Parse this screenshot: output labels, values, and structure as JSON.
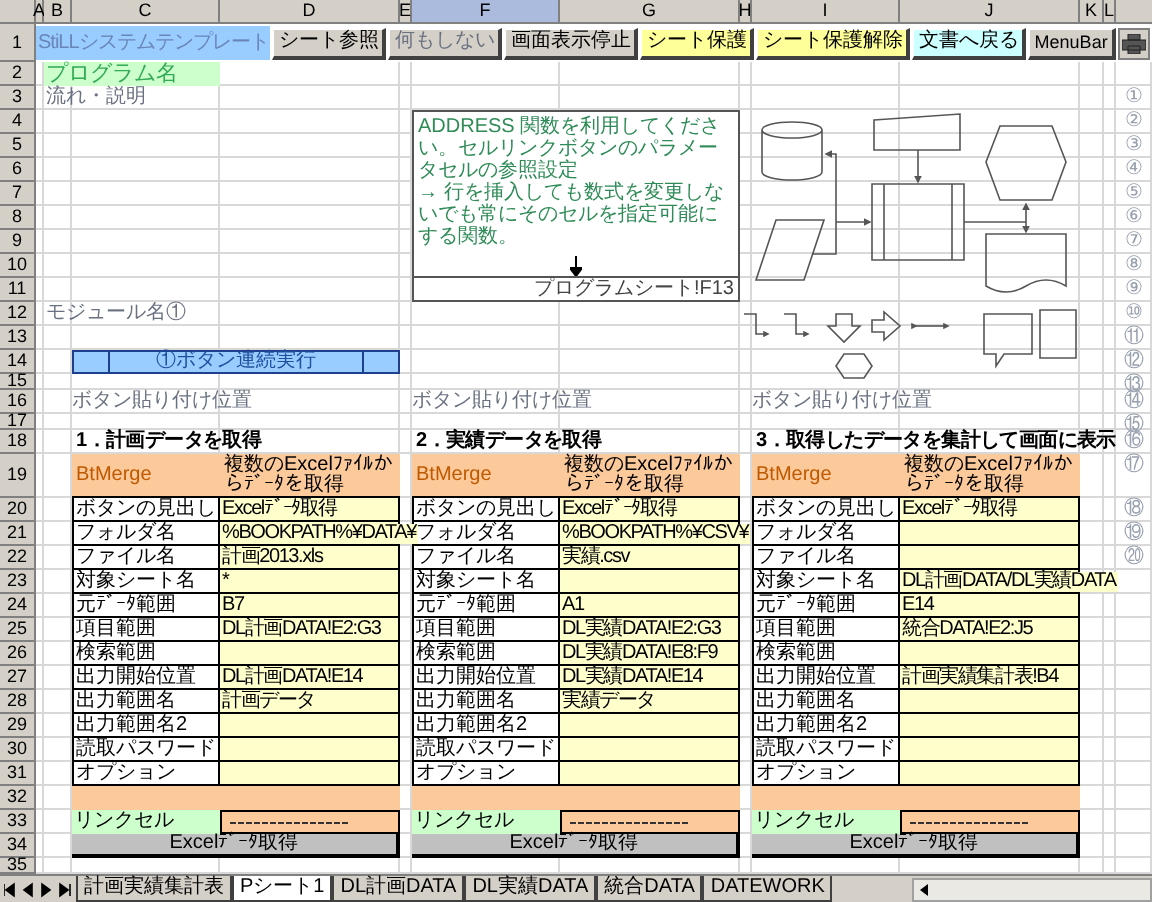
{
  "columns": [
    {
      "label": "A",
      "selected": false
    },
    {
      "label": "B",
      "selected": false
    },
    {
      "label": "C",
      "selected": false
    },
    {
      "label": "D",
      "selected": false
    },
    {
      "label": "E",
      "selected": false
    },
    {
      "label": "F",
      "selected": true
    },
    {
      "label": "G",
      "selected": false
    },
    {
      "label": "H",
      "selected": false
    },
    {
      "label": "I",
      "selected": false
    },
    {
      "label": "J",
      "selected": false
    },
    {
      "label": "K",
      "selected": false
    },
    {
      "label": "L",
      "selected": false
    }
  ],
  "row_numbers": [
    "1",
    "2",
    "3",
    "4",
    "5",
    "6",
    "7",
    "8",
    "9",
    "10",
    "11",
    "12",
    "13",
    "14",
    "15",
    "16",
    "17",
    "18",
    "19",
    "20",
    "21",
    "22",
    "23",
    "24",
    "25",
    "26",
    "27",
    "28",
    "29",
    "30",
    "31",
    "32",
    "33",
    "34",
    "35"
  ],
  "title_cell": "StiLLシステムテンプレート",
  "toolbar": [
    {
      "label": "シート参照",
      "color": "#d4d0c8",
      "disabled": false
    },
    {
      "label": "何もしない",
      "color": "#d4d0c8",
      "disabled": true
    },
    {
      "label": "画面表示停止",
      "color": "#d4d0c8",
      "disabled": false
    },
    {
      "label": "シート保護",
      "color": "#ffff99",
      "disabled": false
    },
    {
      "label": "シート保護解除",
      "color": "#ffff99",
      "disabled": false
    },
    {
      "label": "文書へ戻る",
      "color": "#ccffff",
      "disabled": false
    },
    {
      "label": "MenuBar",
      "color": "#d4d0c8",
      "disabled": false
    }
  ],
  "program_name": "プログラム名",
  "flow_heading": "流れ・説明",
  "note": {
    "paragraphs": [
      "ADDRESS 関数を利用してください。セルリンクボタンのパラメータセルの参照設定",
      "→ 行を挿入しても数式を変更しないでも常にそのセルを指定可能にする関数。"
    ],
    "reference": "プログラムシート!F13"
  },
  "module_heading": "モジュール名①",
  "run_all_button": "①ボタン連続実行",
  "markers": [
    "①",
    "②",
    "③",
    "④",
    "⑤",
    "⑥",
    "⑦",
    "⑧",
    "⑨",
    "⑩",
    "⑪",
    "⑫",
    "⑬",
    "⑭",
    "⑮",
    "⑯",
    "⑰",
    "⑱",
    "⑲",
    "⑳"
  ],
  "blocks": [
    {
      "paste_hint": "ボタン貼り付け位置",
      "title": "1．計画データを取得",
      "header": "BtMerge",
      "description": "複数のExcelﾌｧｲﾙからﾃﾞｰﾀを取得",
      "params": [
        {
          "label": "ボタンの見出し",
          "value": "Excelﾃﾞｰﾀ取得"
        },
        {
          "label": "フォルダ名",
          "value": "%BOOKPATH%¥DATA¥"
        },
        {
          "label": "ファイル名",
          "value": "計画2013.xls"
        },
        {
          "label": "対象シート名",
          "value": "*"
        },
        {
          "label": "元ﾃﾞｰﾀ範囲",
          "value": "B7"
        },
        {
          "label": "項目範囲",
          "value": "DL計画DATA!E2:G3"
        },
        {
          "label": "検索範囲"
        },
        {
          "label": "出力開始位置",
          "value": "DL計画DATA!E14"
        },
        {
          "label": "出力範囲名",
          "value": "計画データ"
        },
        {
          "label": "出力範囲名2"
        },
        {
          "label": "読取パスワード"
        },
        {
          "label": "オプション"
        }
      ],
      "link_label": "リンクセル",
      "button": "Excelﾃﾞｰﾀ取得"
    },
    {
      "paste_hint": "ボタン貼り付け位置",
      "title": "2．実績データを取得",
      "header": "BtMerge",
      "description": "複数のExcelﾌｧｲﾙからﾃﾞｰﾀを取得",
      "params": [
        {
          "label": "ボタンの見出し",
          "value": "Excelﾃﾞｰﾀ取得"
        },
        {
          "label": "フォルダ名",
          "value": "%BOOKPATH%¥CSV¥"
        },
        {
          "label": "ファイル名",
          "value": "実績.csv"
        },
        {
          "label": "対象シート名"
        },
        {
          "label": "元ﾃﾞｰﾀ範囲",
          "value": "A1"
        },
        {
          "label": "項目範囲",
          "value": "DL実績DATA!E2:G3"
        },
        {
          "label": "検索範囲",
          "value": "DL実績DATA!E8:F9"
        },
        {
          "label": "出力開始位置",
          "value": "DL実績DATA!E14"
        },
        {
          "label": "出力範囲名",
          "value": "実績データ"
        },
        {
          "label": "出力範囲名2"
        },
        {
          "label": "読取パスワード"
        },
        {
          "label": "オプション"
        }
      ],
      "link_label": "リンクセル",
      "button": "Excelﾃﾞｰﾀ取得"
    },
    {
      "paste_hint": "ボタン貼り付け位置",
      "title": "3．取得したデータを集計して画面に表示",
      "header": "BtMerge",
      "description": "複数のExcelﾌｧｲﾙからﾃﾞｰﾀを取得",
      "params": [
        {
          "label": "ボタンの見出し",
          "value": "Excelﾃﾞｰﾀ取得"
        },
        {
          "label": "フォルダ名"
        },
        {
          "label": "ファイル名"
        },
        {
          "label": "対象シート名",
          "value": "DL計画DATA/DL実績DATA"
        },
        {
          "label": "元ﾃﾞｰﾀ範囲",
          "value": "E14"
        },
        {
          "label": "項目範囲",
          "value": "統合DATA!E2:J5"
        },
        {
          "label": "検索範囲"
        },
        {
          "label": "出力開始位置",
          "value": "計画実績集計表!B4"
        },
        {
          "label": "出力範囲名"
        },
        {
          "label": "出力範囲名2"
        },
        {
          "label": "読取パスワード"
        },
        {
          "label": "オプション"
        }
      ],
      "link_label": "リンクセル",
      "button": "Excelﾃﾞｰﾀ取得"
    }
  ],
  "sheet_tabs": [
    {
      "label": "計画実績集計表",
      "selected": false
    },
    {
      "label": "Pシート1",
      "selected": true
    },
    {
      "label": "DL計画DATA",
      "selected": false
    },
    {
      "label": "DL実績DATA",
      "selected": false
    },
    {
      "label": "統合DATA",
      "selected": false
    },
    {
      "label": "DATEWORK",
      "selected": false
    }
  ]
}
